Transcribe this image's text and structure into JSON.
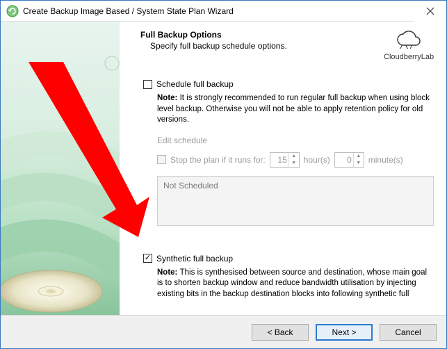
{
  "window": {
    "title": "Create Backup Image Based / System State Plan Wizard"
  },
  "header": {
    "title": "Full Backup Options",
    "subtitle": "Specify full backup schedule options."
  },
  "brand": {
    "label": "CloudberryLab"
  },
  "scheduleFull": {
    "label": "Schedule full backup",
    "checked": false,
    "noteLabel": "Note:",
    "noteText": "It is strongly recommended to run regular full backup when using block level backup. Otherwise you will not be able to apply retention policy for old versions.",
    "editSchedule": "Edit schedule",
    "stopPlanLabel": "Stop the plan if it runs for:",
    "hoursValue": "15",
    "hoursUnit": "hour(s)",
    "minutesValue": "0",
    "minutesUnit": "minute(s)",
    "statusBox": "Not Scheduled"
  },
  "synthetic": {
    "label": "Synthetic full backup",
    "checked": true,
    "noteLabel": "Note:",
    "noteText": "This is synthesised between source and destination, whose main goal is to shorten backup window and reduce bandwidth utilisation by injecting existing bits in the backup destination blocks into following synthetic full"
  },
  "footer": {
    "back": "< Back",
    "next": "Next >",
    "cancel": "Cancel"
  }
}
